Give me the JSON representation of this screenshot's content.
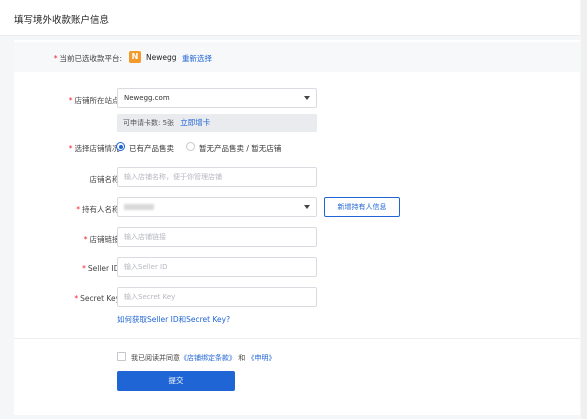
{
  "header": {
    "title": "填写境外收款账户信息"
  },
  "platform": {
    "label": "当前已选收款平台:",
    "logo_letter": "N",
    "name": "Newegg",
    "reselect_link": "重新选择"
  },
  "site": {
    "label": "店铺所在站点:",
    "value": "Newegg.com",
    "info_text": "可申请卡数: 5张",
    "apply_link": "立即增卡"
  },
  "store_status": {
    "label": "选择店铺情况:",
    "options": [
      "已有产品售卖",
      "暂无产品售卖 / 暂无店铺"
    ],
    "selected_index": 0
  },
  "store_name": {
    "label": "店铺名称:",
    "placeholder": "输入店铺名称，便于你管理店铺"
  },
  "holder": {
    "label": "持有人名称:",
    "add_button": "新增持有人信息"
  },
  "store_link": {
    "label": "店铺链接:",
    "placeholder": "输入店铺链接"
  },
  "seller_id": {
    "label": "Seller ID:",
    "placeholder": "输入Seller ID"
  },
  "secret_key": {
    "label": "Secret Key:",
    "placeholder": "输入Secret Key",
    "help_link": "如何获取Seller ID和Secret Key?"
  },
  "agreement": {
    "prefix": "我已阅读并同意",
    "terms": "《店铺绑定条款》",
    "and": "和",
    "statement": "《申明》"
  },
  "submit": {
    "label": "提交"
  }
}
